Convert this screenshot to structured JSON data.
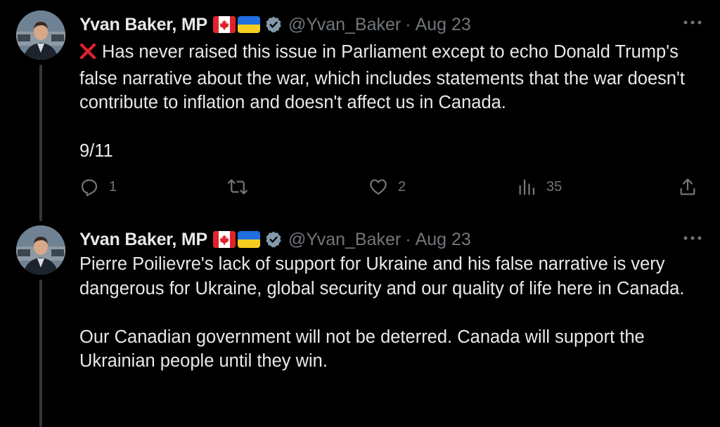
{
  "tweets": [
    {
      "author": {
        "name": "Yvan Baker, MP",
        "handle": "@Yvan_Baker",
        "separator": "·",
        "date": "Aug 23"
      },
      "paragraphs": [
        "Has never raised this issue in Parliament except to echo Donald Trump's false narrative about the war, which includes statements that the war doesn't contribute to inflation and doesn't affect us in Canada.",
        "9/11"
      ],
      "leading_icon": "cross-mark-emoji",
      "stats": {
        "replies": "1",
        "reposts": "",
        "likes": "2",
        "views": "35"
      }
    },
    {
      "author": {
        "name": "Yvan Baker, MP",
        "handle": "@Yvan_Baker",
        "separator": "·",
        "date": "Aug 23"
      },
      "paragraphs": [
        "Pierre Poilievre's lack of support for Ukraine and his false narrative is very dangerous for Ukraine, global security and our quality of life here in Canada.",
        "Our Canadian government will not be deterred. Canada will support the Ukrainian people until they win."
      ]
    }
  ],
  "icons": {
    "flags": [
      "canada-flag-icon",
      "ukraine-flag-icon"
    ],
    "verified": "verified-badge-icon",
    "more": "more-options-icon",
    "actions": [
      "reply-icon",
      "repost-icon",
      "like-icon",
      "views-icon",
      "share-icon"
    ]
  },
  "colors": {
    "background": "#000000",
    "text": "#e7e9ea",
    "secondary_text": "#71767b",
    "thread_line": "#333639",
    "cross_mark": "#e0212f"
  }
}
